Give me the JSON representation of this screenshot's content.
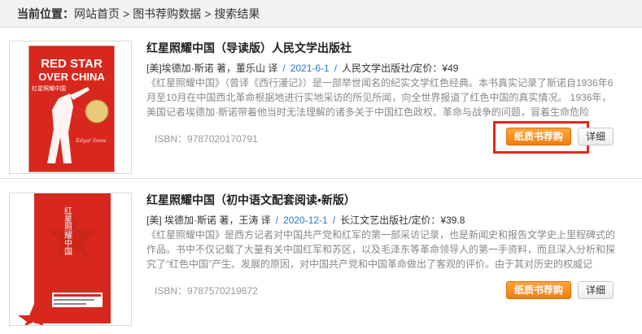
{
  "breadcrumb": {
    "label": "当前位置：",
    "items": [
      "网站首页",
      "图书荐购数据",
      "搜索结果"
    ],
    "separator": ">"
  },
  "results": [
    {
      "title": "红星照耀中国（导读版）人民文学出版社",
      "authors": "[美]埃德加·斯诺 著，董乐山 译",
      "date": "2021-6-1",
      "publisher": "人民文学出版社",
      "price": "/定价：¥49",
      "description": "《红星照耀中国》（曾译《西行漫记》）是一部举世闻名的纪实文学红色经典。本书真实记录了斯诺自1936年6月至10月在中国西北革命根据地进行实地采访的所见所闻，向全世界报道了红色中国的真实情况。 1936年，美国记者埃德加·斯诺带着他当时无法理解的诸多关于中国红色政权、革命与战争的问题，冒着生命危险",
      "isbn": "ISBN：9787020170791",
      "buy_label": "纸质书荐购",
      "detail_label": "详细",
      "cover": {
        "line1": "RED STAR",
        "line2": "OVER CHINA",
        "cn_title": "红星照耀中国"
      }
    },
    {
      "title": "红星照耀中国（初中语文配套阅读•新版）",
      "authors": "[美] 埃德加·斯诺 著，王涛 译",
      "date": "2020-12-1",
      "publisher": "长江文艺出版社",
      "price": "/定价：¥39.8",
      "description": "《红星照耀中国》是西方记者对中国共产党和红军的第一部采访记录，也是新闻史和报告文学史上里程碑式的作品。书中不仅记载了大量有关中国红军和苏区，以及毛泽东等革命领导人的第一手资料，而且深入分析和探究了“红色中国”产生、发展的原因，对中国共产党和中国革命做出了客观的评价。由于其对历史的权威记",
      "isbn": "ISBN：9787570219872",
      "buy_label": "纸质书荐购",
      "detail_label": "详细",
      "cover": {
        "cn_title": "红星照耀中国"
      }
    }
  ],
  "colors": {
    "accent_orange": "#f08a1c",
    "link_blue": "#2b74d6",
    "highlight_red": "#e8261a",
    "cover_red": "#d8281e"
  }
}
